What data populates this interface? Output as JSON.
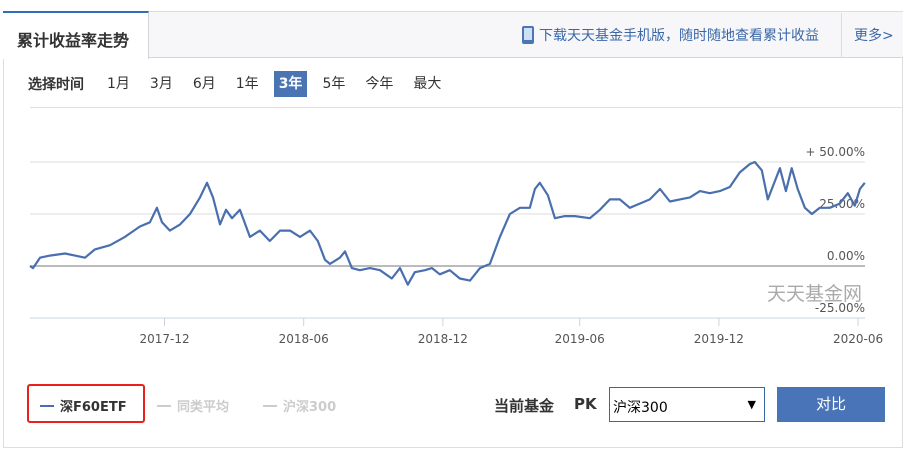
{
  "tabs": {
    "active": "累计收益率走势",
    "download": "下载天天基金手机版，随时随地查看累计收益",
    "more": "更多>"
  },
  "range": {
    "label": "选择时间",
    "items": [
      "1月",
      "3月",
      "6月",
      "1年",
      "3年",
      "5年",
      "今年",
      "最大"
    ],
    "selected": "3年"
  },
  "watermark": "天天基金网",
  "legend": [
    {
      "name": "深F60ETF",
      "color": "#4a6fae",
      "active": true
    },
    {
      "name": "同类平均",
      "color": "#cccccc",
      "active": false
    },
    {
      "name": "沪深300",
      "color": "#cccccc",
      "active": false
    }
  ],
  "compare": {
    "label": "当前基金",
    "pk": "PK",
    "select_value": "沪深300",
    "button": "对比"
  },
  "chart_data": {
    "type": "line",
    "x_unit": "months since 2017-06",
    "xticks": [
      {
        "m": 5.8,
        "label": "2017-12"
      },
      {
        "m": 11.8,
        "label": "2018-06"
      },
      {
        "m": 17.8,
        "label": "2018-12"
      },
      {
        "m": 23.7,
        "label": "2019-06"
      },
      {
        "m": 29.7,
        "label": "2019-12"
      },
      {
        "m": 35.7,
        "label": "2020-06"
      }
    ],
    "yticks": [
      {
        "v": 50,
        "label": "+ 50.00%"
      },
      {
        "v": 25,
        "label": "25.00%"
      },
      {
        "v": 0,
        "label": "0.00%"
      },
      {
        "v": -25,
        "label": "-25.00%"
      }
    ],
    "ylim": [
      -25,
      55
    ],
    "xlim": [
      0,
      36
    ],
    "series": [
      {
        "name": "深F60ETF",
        "color": "#4a6fae",
        "x": [
          0,
          0.13,
          0.43,
          0.86,
          1.51,
          1.94,
          2.37,
          2.8,
          3.45,
          4.09,
          4.74,
          5.17,
          5.47,
          5.69,
          6.03,
          6.47,
          6.9,
          7.33,
          7.63,
          7.89,
          8.19,
          8.45,
          8.71,
          9.05,
          9.48,
          9.91,
          10.34,
          10.78,
          11.21,
          11.64,
          12.07,
          12.41,
          12.72,
          12.93,
          13.36,
          13.58,
          13.88,
          14.22,
          14.66,
          15.09,
          15.6,
          15.95,
          16.29,
          16.59,
          17.03,
          17.33,
          17.67,
          18.1,
          18.53,
          18.97,
          19.4,
          19.83,
          20.26,
          20.69,
          21.12,
          21.55,
          21.77,
          21.98,
          22.33,
          22.63,
          23.06,
          23.49,
          24.14,
          24.57,
          25,
          25.43,
          25.86,
          26.29,
          26.72,
          27.16,
          27.59,
          28.02,
          28.45,
          28.88,
          29.31,
          29.74,
          30.17,
          30.6,
          31.03,
          31.25,
          31.55,
          31.81,
          32.33,
          32.59,
          32.84,
          33.1,
          33.41,
          33.71,
          34.05,
          34.48,
          34.91,
          35.26,
          35.56,
          35.78,
          35.99
        ],
        "values": [
          0,
          -1,
          4,
          5,
          6,
          5,
          4,
          8,
          10,
          14,
          19,
          21,
          28,
          21,
          17,
          20,
          25,
          33,
          40,
          33,
          20,
          27,
          23,
          27,
          14,
          17,
          12,
          17,
          17,
          14,
          17,
          12,
          3,
          1,
          4,
          7,
          -1,
          -2,
          -1,
          -2,
          -6,
          -1,
          -9,
          -3,
          -2,
          -1,
          -4,
          -2,
          -6,
          -7,
          -1,
          1,
          14,
          25,
          28,
          28,
          37,
          40,
          34,
          23,
          24,
          24,
          23,
          27,
          32,
          32,
          28,
          30,
          32,
          37,
          31,
          32,
          33,
          36,
          35,
          36,
          38,
          45,
          49,
          50,
          46,
          32,
          47,
          36,
          47,
          37,
          28,
          25,
          28,
          28,
          30,
          35,
          29,
          37,
          40
        ]
      }
    ]
  }
}
